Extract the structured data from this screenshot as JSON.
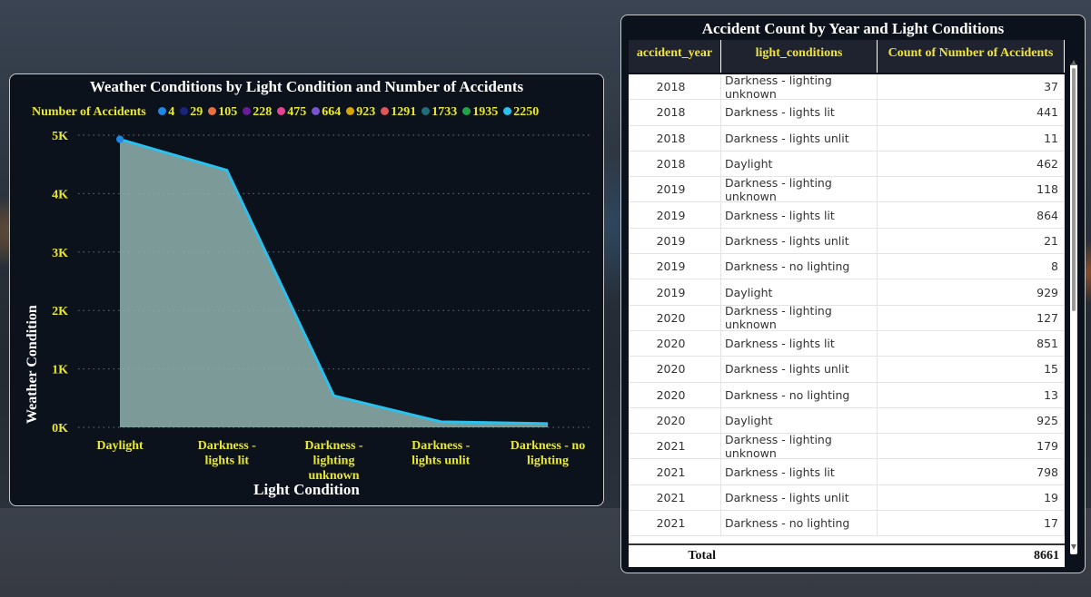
{
  "left_chart": {
    "title": "Weather Conditions by Light Condition and Number of Accidents",
    "legend_title": "Number of Accidents",
    "legend_items": [
      {
        "label": "4",
        "color": "#1e88e5"
      },
      {
        "label": "29",
        "color": "#1a237e"
      },
      {
        "label": "105",
        "color": "#e6713f"
      },
      {
        "label": "228",
        "color": "#6a1b9a"
      },
      {
        "label": "475",
        "color": "#e84393"
      },
      {
        "label": "664",
        "color": "#7b52d0"
      },
      {
        "label": "923",
        "color": "#d8a400"
      },
      {
        "label": "1291",
        "color": "#e0555a"
      },
      {
        "label": "1733",
        "color": "#1f6f7a"
      },
      {
        "label": "1935",
        "color": "#22a34a"
      },
      {
        "label": "2250",
        "color": "#29c2ee"
      }
    ]
  },
  "chart_data": {
    "type": "area",
    "title": "Weather Conditions by Light Condition and Number of Accidents",
    "xlabel": "Light Condition",
    "ylabel": "Weather Condition",
    "categories": [
      "Daylight",
      "Darkness - lights lit",
      "Darkness - lighting unknown",
      "Darkness - lights unlit",
      "Darkness - no lighting"
    ],
    "category_lines": [
      [
        "Daylight"
      ],
      [
        "Darkness -",
        "lights lit"
      ],
      [
        "Darkness -",
        "lighting",
        "unknown"
      ],
      [
        "Darkness -",
        "lights unlit"
      ],
      [
        "Darkness - no",
        "lighting"
      ]
    ],
    "values": [
      4930,
      4400,
      540,
      95,
      65
    ],
    "ylim": [
      0,
      5000
    ],
    "yticks": [
      0,
      1000,
      2000,
      3000,
      4000,
      5000
    ],
    "ytick_labels": [
      "0K",
      "1K",
      "2K",
      "3K",
      "4K",
      "5K"
    ],
    "line_color": "#29c2ee",
    "fill_color": "#8fb3ae",
    "grid": true
  },
  "table": {
    "title": "Accident Count by Year and Light Conditions",
    "headers": [
      "accident_year",
      "light_conditions",
      "Count of Number of Accidents"
    ],
    "rows": [
      [
        "2018",
        "Darkness - lighting unknown",
        "37"
      ],
      [
        "2018",
        "Darkness - lights lit",
        "441"
      ],
      [
        "2018",
        "Darkness - lights unlit",
        "11"
      ],
      [
        "2018",
        "Daylight",
        "462"
      ],
      [
        "2019",
        "Darkness - lighting unknown",
        "118"
      ],
      [
        "2019",
        "Darkness - lights lit",
        "864"
      ],
      [
        "2019",
        "Darkness - lights unlit",
        "21"
      ],
      [
        "2019",
        "Darkness - no lighting",
        "8"
      ],
      [
        "2019",
        "Daylight",
        "929"
      ],
      [
        "2020",
        "Darkness - lighting unknown",
        "127"
      ],
      [
        "2020",
        "Darkness - lights lit",
        "851"
      ],
      [
        "2020",
        "Darkness - lights unlit",
        "15"
      ],
      [
        "2020",
        "Darkness - no lighting",
        "13"
      ],
      [
        "2020",
        "Daylight",
        "925"
      ],
      [
        "2021",
        "Darkness - lighting unknown",
        "179"
      ],
      [
        "2021",
        "Darkness - lights lit",
        "798"
      ],
      [
        "2021",
        "Darkness - lights unlit",
        "19"
      ],
      [
        "2021",
        "Darkness - no lighting",
        "17"
      ]
    ],
    "total_label": "Total",
    "total_value": "8661"
  }
}
